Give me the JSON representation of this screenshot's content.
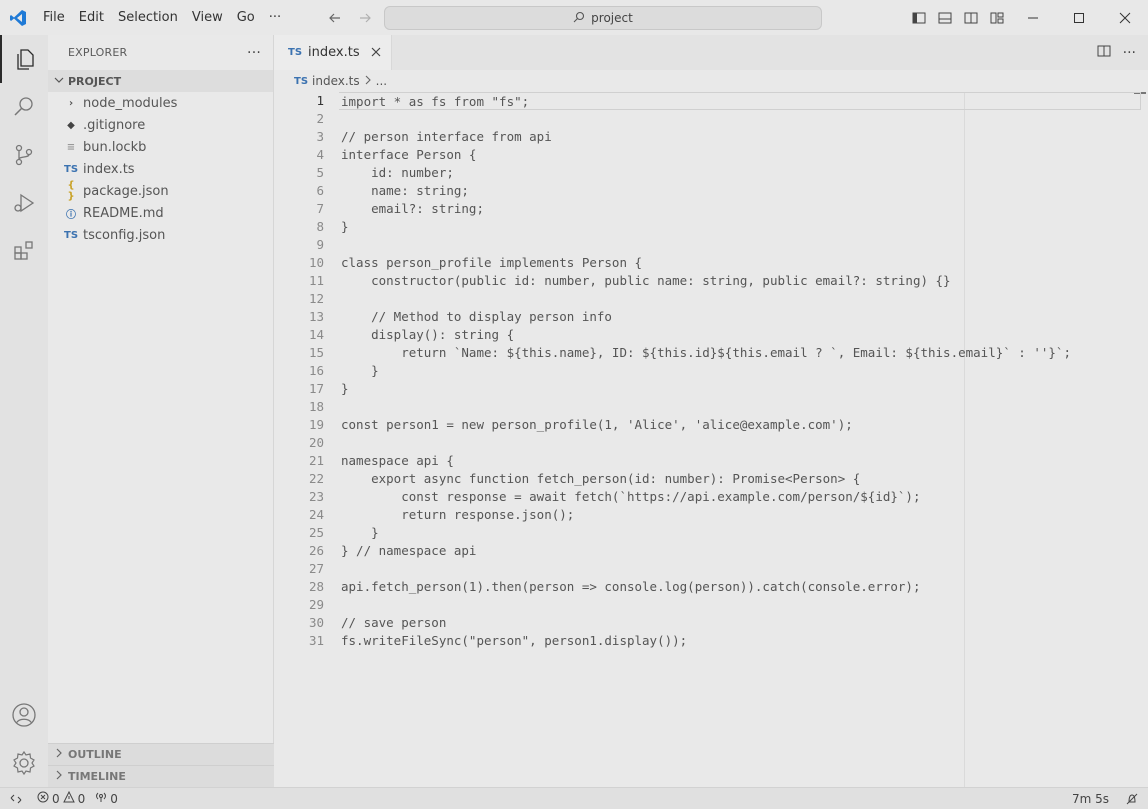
{
  "titlebar": {
    "menu": [
      "File",
      "Edit",
      "Selection",
      "View",
      "Go"
    ],
    "more": "···",
    "search_text": "project",
    "back_icon": "arrow-left-icon",
    "forward_icon": "arrow-right-icon"
  },
  "activitybar": {
    "items": [
      "explorer-icon",
      "search-icon",
      "source-control-icon",
      "run-debug-icon",
      "extensions-icon"
    ],
    "bottom": [
      "account-icon",
      "settings-gear-icon"
    ]
  },
  "sidebar": {
    "title": "EXPLORER",
    "more": "···",
    "section": "PROJECT",
    "files": [
      {
        "name": "node_modules",
        "icon": "chevron-right-icon",
        "glyph": "›",
        "color": "#555555"
      },
      {
        "name": ".gitignore",
        "icon": "git-icon",
        "glyph": "◆",
        "color": "#444444"
      },
      {
        "name": "bun.lockb",
        "icon": "file-lines-icon",
        "glyph": "≡",
        "color": "#999999"
      },
      {
        "name": "index.ts",
        "icon": "typescript-icon",
        "glyph": "TS",
        "color": "#3b72b0"
      },
      {
        "name": "package.json",
        "icon": "json-icon",
        "glyph": "{ }",
        "color": "#c9a227"
      },
      {
        "name": "README.md",
        "icon": "info-icon",
        "glyph": "ⓘ",
        "color": "#3b72b0"
      },
      {
        "name": "tsconfig.json",
        "icon": "tsconfig-icon",
        "glyph": "TS",
        "color": "#3b72b0"
      }
    ],
    "outline": "OUTLINE",
    "timeline": "TIMELINE"
  },
  "editor": {
    "tab_label": "index.ts",
    "tab_badge": "TS",
    "breadcrumb_file": "index.ts",
    "breadcrumb_rest": "...",
    "current_line": 1,
    "lines": [
      "import * as fs from \"fs\";",
      "",
      "// person interface from api",
      "interface Person {",
      "    id: number;",
      "    name: string;",
      "    email?: string;",
      "}",
      "",
      "class person_profile implements Person {",
      "    constructor(public id: number, public name: string, public email?: string) {}",
      "",
      "    // Method to display person info",
      "    display(): string {",
      "        return `Name: ${this.name}, ID: ${this.id}${this.email ? `, Email: ${this.email}` : ''}`;",
      "    }",
      "}",
      "",
      "const person1 = new person_profile(1, 'Alice', 'alice@example.com');",
      "",
      "namespace api {",
      "    export async function fetch_person(id: number): Promise<Person> {",
      "        const response = await fetch(`https://api.example.com/person/${id}`);",
      "        return response.json();",
      "    }",
      "} // namespace api",
      "",
      "api.fetch_person(1).then(person => console.log(person)).catch(console.error);",
      "",
      "// save person",
      "fs.writeFileSync(\"person\", person1.display());"
    ]
  },
  "statusbar": {
    "errors": "0",
    "warnings": "0",
    "ports": "0",
    "time": "7m 5s"
  }
}
